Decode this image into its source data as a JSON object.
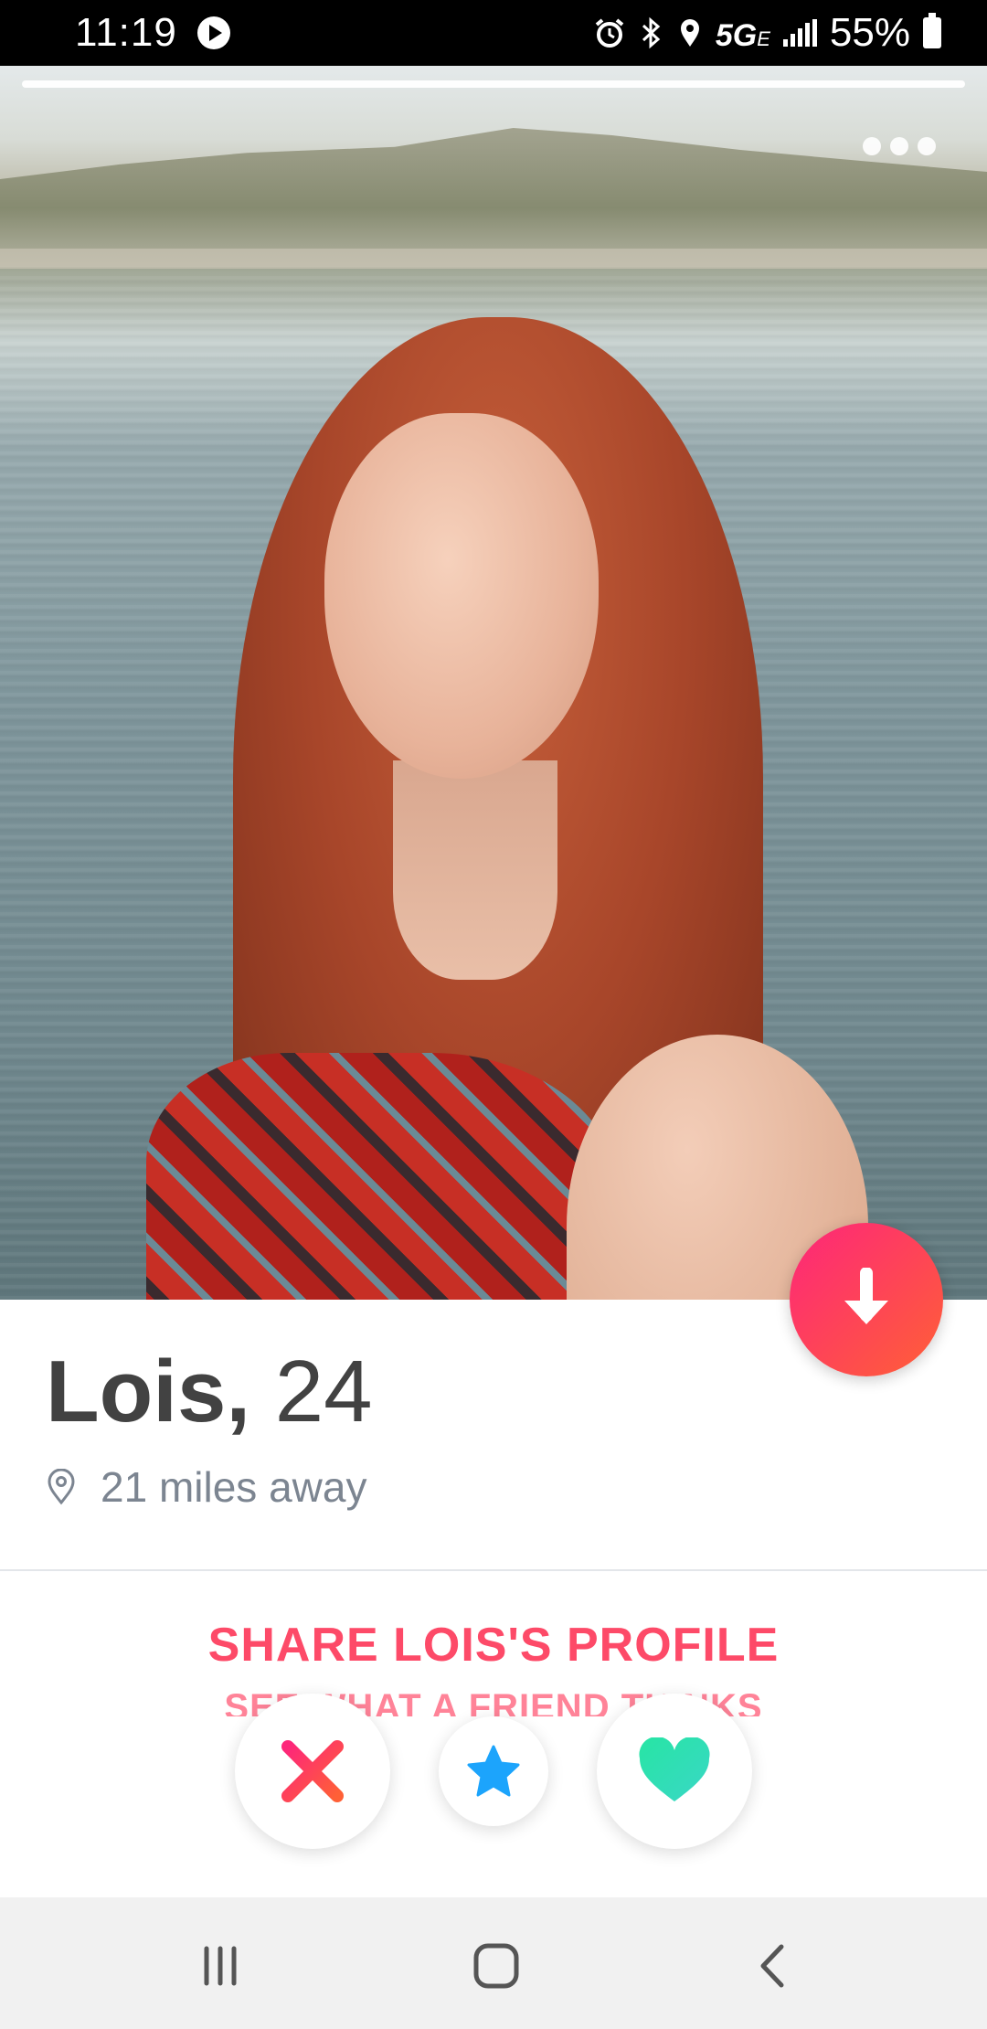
{
  "status_bar": {
    "time": "11:19",
    "network": "5G",
    "network_sub": "E",
    "battery": "55%"
  },
  "photo": {
    "pages": 1,
    "current_page": 1
  },
  "profile": {
    "name": "Lois,",
    "age": "24",
    "distance": "21 miles away"
  },
  "share": {
    "title": "SHARE LOIS'S PROFILE",
    "subtitle": "SEE WHAT A FRIEND THINKS"
  },
  "actions": {
    "nope_icon": "x-icon",
    "super_like_icon": "star-icon",
    "like_icon": "heart-icon"
  },
  "colors": {
    "brand_gradient_start": "#fd267a",
    "brand_gradient_end": "#ff6036",
    "nope": "#fd5068",
    "super_like": "#1ca4fc",
    "like": "#2fe5a7"
  }
}
